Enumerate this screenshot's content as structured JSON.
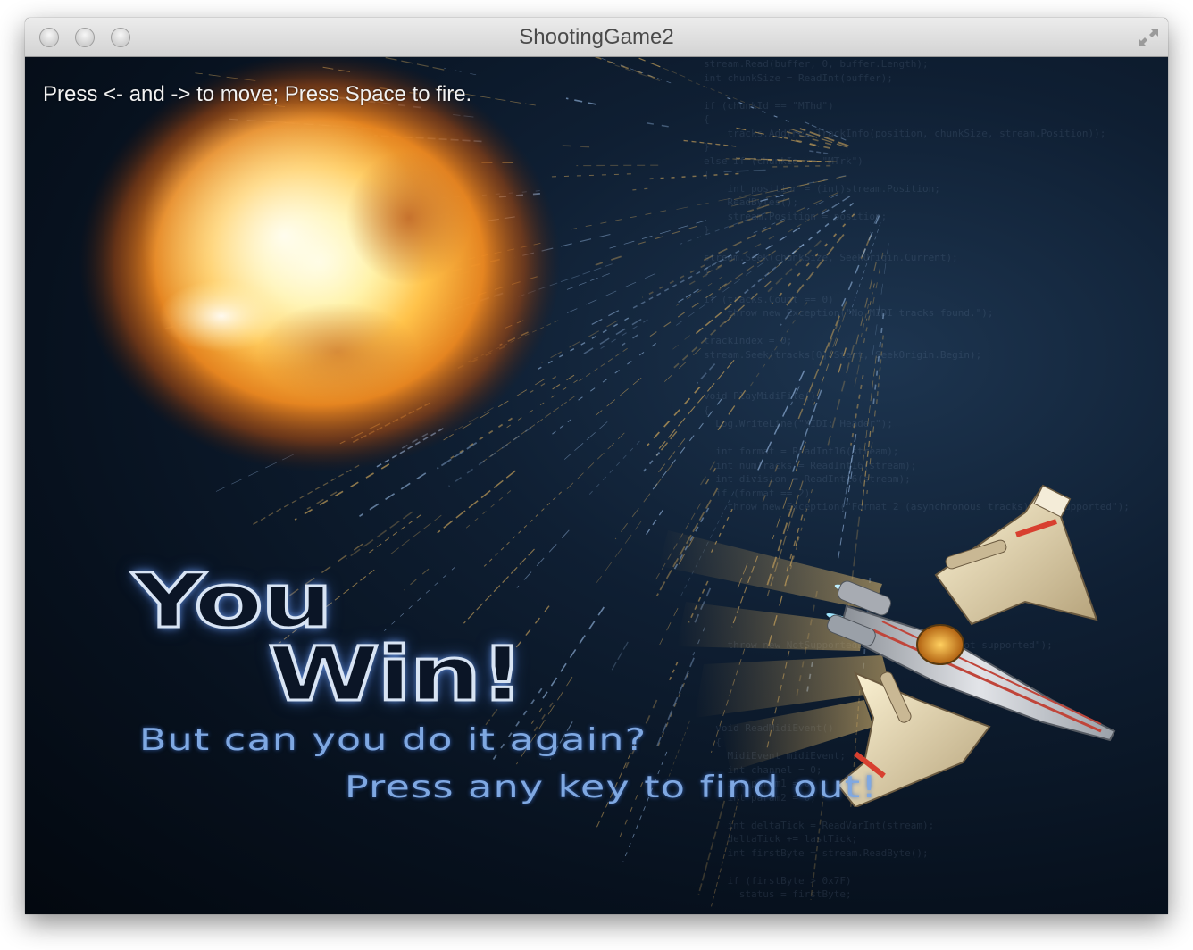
{
  "window": {
    "title": "ShootingGame2"
  },
  "game": {
    "instructions": "Press <- and -> to move; Press Space to fire.",
    "result_line1": "You",
    "result_line2": "Win!",
    "subtitle": "But can you do it again?",
    "prompt": "Press any key to find out!"
  },
  "colors": {
    "background": "#0a1628",
    "title_text": "#4a4a4a",
    "win_outline": "#d8e4f4",
    "subtitle_text": "#7fa8e2",
    "instructions_text": "#f2f2f2"
  }
}
